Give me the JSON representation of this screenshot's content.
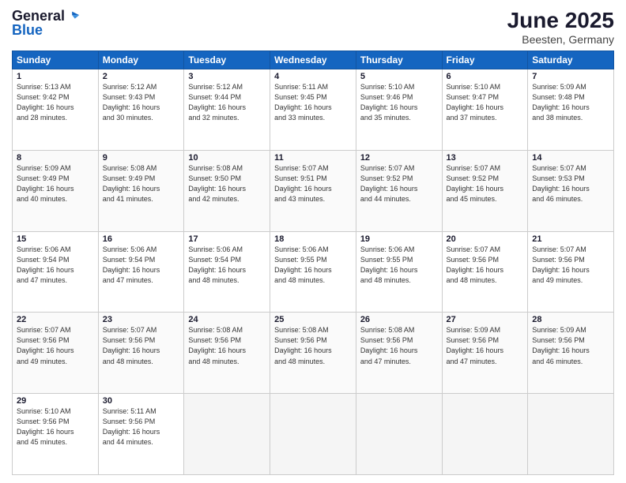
{
  "header": {
    "logo_line1": "General",
    "logo_line2": "Blue",
    "title": "June 2025",
    "subtitle": "Beesten, Germany"
  },
  "days_of_week": [
    "Sunday",
    "Monday",
    "Tuesday",
    "Wednesday",
    "Thursday",
    "Friday",
    "Saturday"
  ],
  "weeks": [
    [
      {
        "day": 1,
        "info": "Sunrise: 5:13 AM\nSunset: 9:42 PM\nDaylight: 16 hours\nand 28 minutes."
      },
      {
        "day": 2,
        "info": "Sunrise: 5:12 AM\nSunset: 9:43 PM\nDaylight: 16 hours\nand 30 minutes."
      },
      {
        "day": 3,
        "info": "Sunrise: 5:12 AM\nSunset: 9:44 PM\nDaylight: 16 hours\nand 32 minutes."
      },
      {
        "day": 4,
        "info": "Sunrise: 5:11 AM\nSunset: 9:45 PM\nDaylight: 16 hours\nand 33 minutes."
      },
      {
        "day": 5,
        "info": "Sunrise: 5:10 AM\nSunset: 9:46 PM\nDaylight: 16 hours\nand 35 minutes."
      },
      {
        "day": 6,
        "info": "Sunrise: 5:10 AM\nSunset: 9:47 PM\nDaylight: 16 hours\nand 37 minutes."
      },
      {
        "day": 7,
        "info": "Sunrise: 5:09 AM\nSunset: 9:48 PM\nDaylight: 16 hours\nand 38 minutes."
      }
    ],
    [
      {
        "day": 8,
        "info": "Sunrise: 5:09 AM\nSunset: 9:49 PM\nDaylight: 16 hours\nand 40 minutes."
      },
      {
        "day": 9,
        "info": "Sunrise: 5:08 AM\nSunset: 9:49 PM\nDaylight: 16 hours\nand 41 minutes."
      },
      {
        "day": 10,
        "info": "Sunrise: 5:08 AM\nSunset: 9:50 PM\nDaylight: 16 hours\nand 42 minutes."
      },
      {
        "day": 11,
        "info": "Sunrise: 5:07 AM\nSunset: 9:51 PM\nDaylight: 16 hours\nand 43 minutes."
      },
      {
        "day": 12,
        "info": "Sunrise: 5:07 AM\nSunset: 9:52 PM\nDaylight: 16 hours\nand 44 minutes."
      },
      {
        "day": 13,
        "info": "Sunrise: 5:07 AM\nSunset: 9:52 PM\nDaylight: 16 hours\nand 45 minutes."
      },
      {
        "day": 14,
        "info": "Sunrise: 5:07 AM\nSunset: 9:53 PM\nDaylight: 16 hours\nand 46 minutes."
      }
    ],
    [
      {
        "day": 15,
        "info": "Sunrise: 5:06 AM\nSunset: 9:54 PM\nDaylight: 16 hours\nand 47 minutes."
      },
      {
        "day": 16,
        "info": "Sunrise: 5:06 AM\nSunset: 9:54 PM\nDaylight: 16 hours\nand 47 minutes."
      },
      {
        "day": 17,
        "info": "Sunrise: 5:06 AM\nSunset: 9:54 PM\nDaylight: 16 hours\nand 48 minutes."
      },
      {
        "day": 18,
        "info": "Sunrise: 5:06 AM\nSunset: 9:55 PM\nDaylight: 16 hours\nand 48 minutes."
      },
      {
        "day": 19,
        "info": "Sunrise: 5:06 AM\nSunset: 9:55 PM\nDaylight: 16 hours\nand 48 minutes."
      },
      {
        "day": 20,
        "info": "Sunrise: 5:07 AM\nSunset: 9:56 PM\nDaylight: 16 hours\nand 48 minutes."
      },
      {
        "day": 21,
        "info": "Sunrise: 5:07 AM\nSunset: 9:56 PM\nDaylight: 16 hours\nand 49 minutes."
      }
    ],
    [
      {
        "day": 22,
        "info": "Sunrise: 5:07 AM\nSunset: 9:56 PM\nDaylight: 16 hours\nand 49 minutes."
      },
      {
        "day": 23,
        "info": "Sunrise: 5:07 AM\nSunset: 9:56 PM\nDaylight: 16 hours\nand 48 minutes."
      },
      {
        "day": 24,
        "info": "Sunrise: 5:08 AM\nSunset: 9:56 PM\nDaylight: 16 hours\nand 48 minutes."
      },
      {
        "day": 25,
        "info": "Sunrise: 5:08 AM\nSunset: 9:56 PM\nDaylight: 16 hours\nand 48 minutes."
      },
      {
        "day": 26,
        "info": "Sunrise: 5:08 AM\nSunset: 9:56 PM\nDaylight: 16 hours\nand 47 minutes."
      },
      {
        "day": 27,
        "info": "Sunrise: 5:09 AM\nSunset: 9:56 PM\nDaylight: 16 hours\nand 47 minutes."
      },
      {
        "day": 28,
        "info": "Sunrise: 5:09 AM\nSunset: 9:56 PM\nDaylight: 16 hours\nand 46 minutes."
      }
    ],
    [
      {
        "day": 29,
        "info": "Sunrise: 5:10 AM\nSunset: 9:56 PM\nDaylight: 16 hours\nand 45 minutes."
      },
      {
        "day": 30,
        "info": "Sunrise: 5:11 AM\nSunset: 9:56 PM\nDaylight: 16 hours\nand 44 minutes."
      },
      null,
      null,
      null,
      null,
      null
    ]
  ]
}
